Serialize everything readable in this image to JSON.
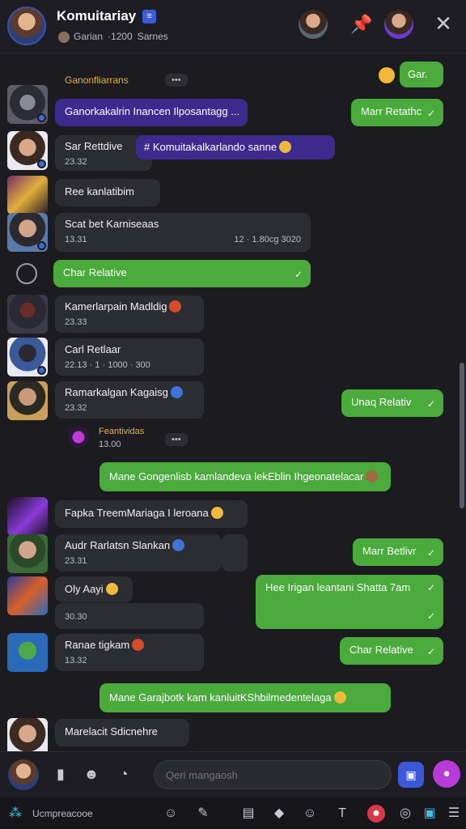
{
  "header": {
    "title": "Komuitariay",
    "badge": "≡",
    "sub_a": "Garian",
    "sub_b": "·1200",
    "sub_c": "Sarnes"
  },
  "messages": {
    "sys1_name": "Ganonfliarrans",
    "sys1_dots": "•••",
    "r1": "Gar.",
    "m1": "Ganorkakalrin Inancen Ilposantagg ...",
    "r2": "Marr Retathc",
    "m2_a": "Sar Rettdive",
    "m2_meta": "23.32",
    "m2_b": "# Komuitakalkarlando sanne",
    "m3": "Ree kanlatibim",
    "m4": "Scat bet Karniseaas",
    "m4_meta": "13.31",
    "m4_right": "12 · 1.80cg 3020",
    "m5": "Char Relative",
    "m6": "Kamerlarpain Madldig",
    "m6_meta": "23.33",
    "m7": "Carl Retlaar",
    "m7_meta": "22.13 · 1 · 1000 · 300",
    "m8": "Ramarkalgan Kagaisg",
    "m8_meta": "23.32",
    "r3": "Unaq Relativ",
    "sys2_name": "Feantividas",
    "sys2_meta": "13.00",
    "sys2_dots": "•••",
    "m9": "Mane Gongenlisb kamlandeva lekEblin Ihgeonatelacar",
    "m10": "Fapka TreemMariaga I leroana",
    "m11": "Audr Rarlatsn Slankan",
    "m11_meta": "23.31",
    "r4": "Marr Betlivr",
    "m12": "Oly Aayi",
    "r5": "Hee Irigan leantani Shatta 7am",
    "m13_meta": "30.30",
    "m14": "Ranae tigkam",
    "m14_meta": "13.32",
    "r6": "Char Relative",
    "m15": "Mane Garajbotk kam kanluitKShbilmedentelaga",
    "m16": "Marelacit Sdicnehre"
  },
  "composer": {
    "placeholder": "Qeri mangaosh"
  },
  "toolbar": {
    "label": "Ucmpreacooe"
  },
  "colors": {
    "green": "#4aaa3c",
    "purple": "#3c2a8c",
    "dark_bubble": "#2c2c33",
    "background": "#1b1b20"
  }
}
